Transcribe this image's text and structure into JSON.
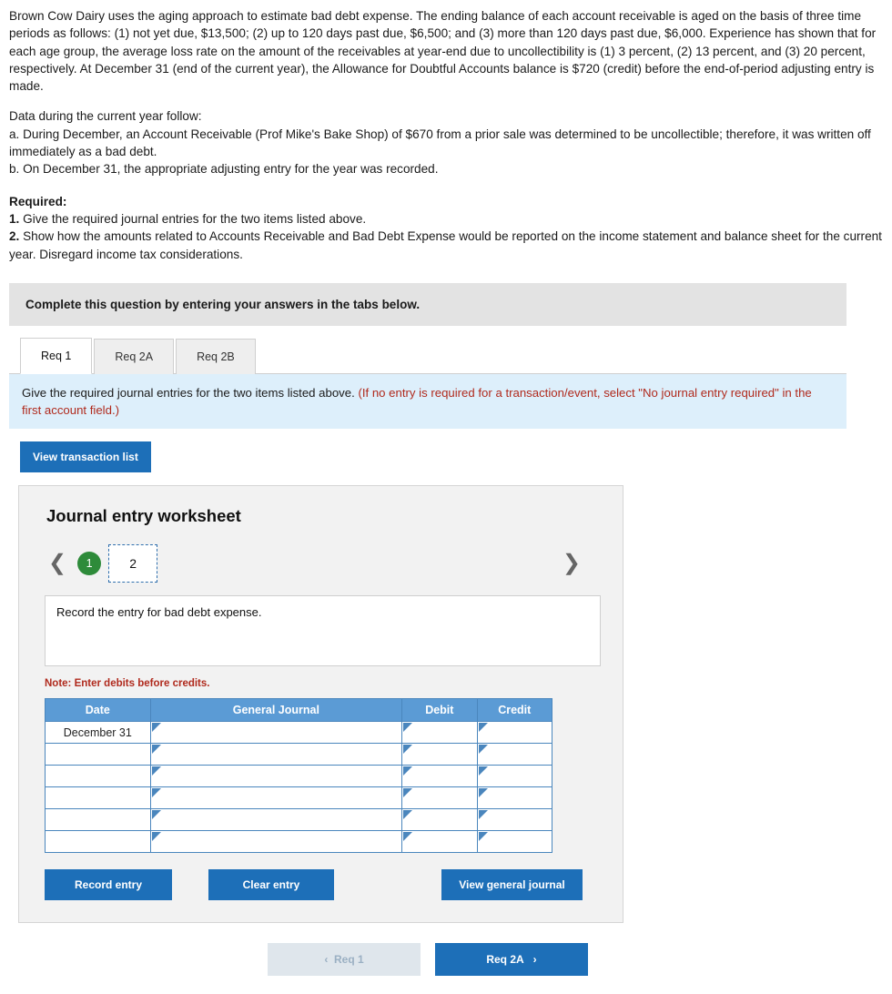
{
  "problem": {
    "paragraph1": "Brown Cow Dairy uses the aging approach to estimate bad debt expense. The ending balance of each account receivable is aged on the basis of three time periods as follows: (1) not yet due, $13,500; (2) up to 120 days past due, $6,500; and (3) more than 120 days past due, $6,000. Experience has shown that for each age group, the average loss rate on the amount of the receivables at year-end due to uncollectibility is (1) 3 percent, (2) 13 percent, and (3) 20 percent, respectively. At December 31 (end of the current year), the Allowance for Doubtful Accounts balance is $720 (credit) before the end-of-period adjusting entry is made.",
    "data_intro": "Data during the current year follow:",
    "item_a": "a. During December, an Account Receivable (Prof Mike's Bake Shop) of $670 from a prior sale  was determined to be uncollectible; therefore, it was written off immediately as a bad debt.",
    "item_b": "b. On December 31, the appropriate adjusting entry for the year was recorded.",
    "required_title": "Required:",
    "required_1_num": "1.",
    "required_1_text": " Give the required journal entries for the two items listed above.",
    "required_2_num": "2.",
    "required_2_text": " Show how the amounts related to Accounts Receivable and Bad Debt Expense would be reported on the income statement and balance sheet for the current year. Disregard income tax considerations."
  },
  "instruction_bar": "Complete this question by entering your answers in the tabs below.",
  "tabs": [
    {
      "label": "Req 1",
      "active": true
    },
    {
      "label": "Req 2A",
      "active": false
    },
    {
      "label": "Req 2B",
      "active": false
    }
  ],
  "info_bar": {
    "main": "Give the required journal entries for the two items listed above.",
    "hint": "(If no entry is required for a transaction/event, select \"No journal entry required\" in the first account field.)"
  },
  "view_transaction_list_label": "View transaction list",
  "worksheet": {
    "title": "Journal entry worksheet",
    "prev_icon": "chevron-left-icon",
    "next_icon": "chevron-right-icon",
    "pages": [
      {
        "label": "1",
        "state": "completed"
      },
      {
        "label": "2",
        "state": "selected"
      }
    ],
    "prompt": "Record the entry for bad debt expense.",
    "note": "Note: Enter debits before credits.",
    "table": {
      "headers": [
        "Date",
        "General Journal",
        "Debit",
        "Credit"
      ],
      "rows": [
        {
          "date": "December 31",
          "account": "",
          "debit": "",
          "credit": ""
        },
        {
          "date": "",
          "account": "",
          "debit": "",
          "credit": ""
        },
        {
          "date": "",
          "account": "",
          "debit": "",
          "credit": ""
        },
        {
          "date": "",
          "account": "",
          "debit": "",
          "credit": ""
        },
        {
          "date": "",
          "account": "",
          "debit": "",
          "credit": ""
        },
        {
          "date": "",
          "account": "",
          "debit": "",
          "credit": ""
        }
      ]
    },
    "record_entry_label": "Record entry",
    "clear_entry_label": "Clear entry",
    "view_general_journal_label": "View general journal"
  },
  "bottom_nav": {
    "prev_arrow": "‹",
    "prev_label": "Req 1",
    "next_label": "Req 2A",
    "next_arrow": "›"
  }
}
